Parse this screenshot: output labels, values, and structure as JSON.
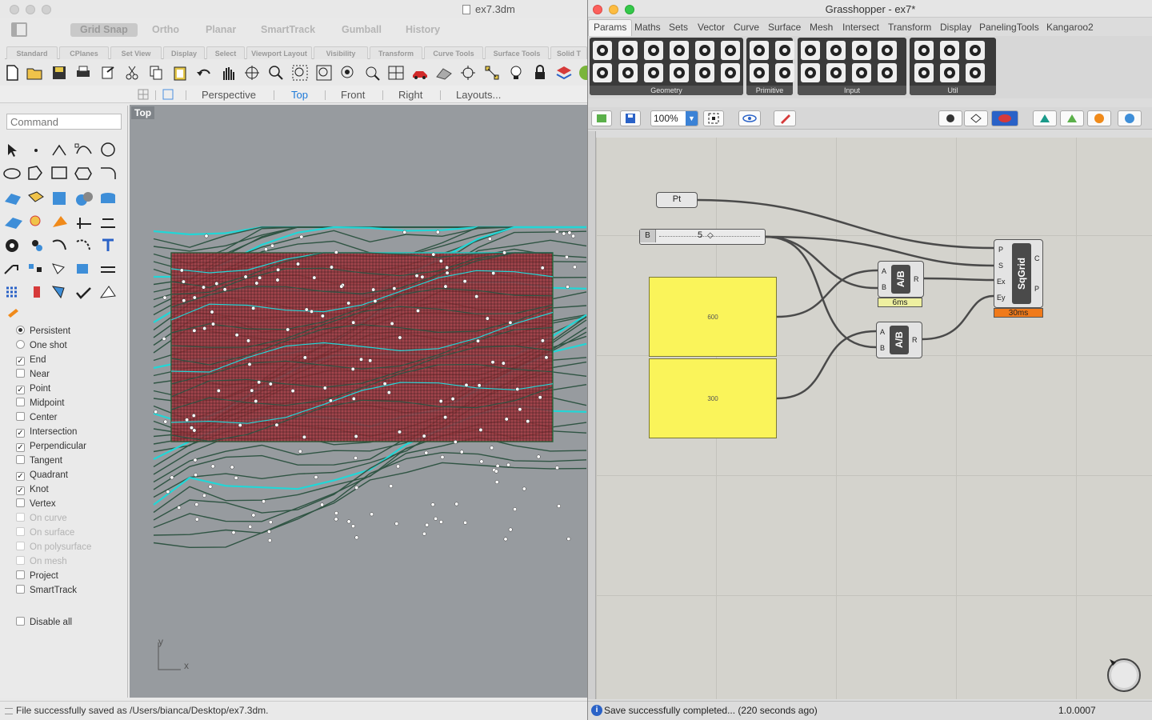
{
  "rhino": {
    "title": "ex7.3dm",
    "modes": [
      "Grid Snap",
      "Ortho",
      "Planar",
      "SmartTrack",
      "Gumball",
      "History"
    ],
    "tabs": [
      "Standard",
      "CPlanes",
      "Set View",
      "Display",
      "Select",
      "Viewport Layout",
      "Visibility",
      "Transform",
      "Curve Tools",
      "Surface Tools",
      "Solid T"
    ],
    "views": [
      "Perspective",
      "Top",
      "Front",
      "Right",
      "Layouts..."
    ],
    "active_view": "Top",
    "command_placeholder": "Command",
    "viewport_label": "Top",
    "axis_y": "y",
    "axis_x": "x",
    "osnaps": [
      {
        "label": "Persistent",
        "type": "radio",
        "checked": true,
        "enabled": true
      },
      {
        "label": "One shot",
        "type": "radio",
        "checked": false,
        "enabled": true
      },
      {
        "label": "End",
        "type": "check",
        "checked": true,
        "enabled": true
      },
      {
        "label": "Near",
        "type": "check",
        "checked": false,
        "enabled": true
      },
      {
        "label": "Point",
        "type": "check",
        "checked": true,
        "enabled": true
      },
      {
        "label": "Midpoint",
        "type": "check",
        "checked": false,
        "enabled": true
      },
      {
        "label": "Center",
        "type": "check",
        "checked": false,
        "enabled": true
      },
      {
        "label": "Intersection",
        "type": "check",
        "checked": true,
        "enabled": true
      },
      {
        "label": "Perpendicular",
        "type": "check",
        "checked": true,
        "enabled": true
      },
      {
        "label": "Tangent",
        "type": "check",
        "checked": false,
        "enabled": true
      },
      {
        "label": "Quadrant",
        "type": "check",
        "checked": true,
        "enabled": true
      },
      {
        "label": "Knot",
        "type": "check",
        "checked": true,
        "enabled": true
      },
      {
        "label": "Vertex",
        "type": "check",
        "checked": false,
        "enabled": true
      },
      {
        "label": "On curve",
        "type": "check",
        "checked": false,
        "enabled": false
      },
      {
        "label": "On surface",
        "type": "check",
        "checked": false,
        "enabled": false
      },
      {
        "label": "On polysurface",
        "type": "check",
        "checked": false,
        "enabled": false
      },
      {
        "label": "On mesh",
        "type": "check",
        "checked": false,
        "enabled": false
      },
      {
        "label": "Project",
        "type": "check",
        "checked": false,
        "enabled": true
      },
      {
        "label": "SmartTrack",
        "type": "check",
        "checked": false,
        "enabled": true
      }
    ],
    "disable_all": "Disable all",
    "status": "File successfully saved as /Users/bianca/Desktop/ex7.3dm.",
    "colors": {
      "grid": "#a3353d",
      "contour": "#2f5443",
      "highlight": "#22d6d6",
      "viewport_bg": "#979b9f"
    }
  },
  "grasshopper": {
    "title": "Grasshopper - ex7*",
    "tabs": [
      "Params",
      "Maths",
      "Sets",
      "Vector",
      "Curve",
      "Surface",
      "Mesh",
      "Intersect",
      "Transform",
      "Display",
      "PanelingTools",
      "Kangaroo2"
    ],
    "active_tab": "Params",
    "panels": [
      "Geometry",
      "Primitive",
      "Input",
      "Util"
    ],
    "zoom": "100%",
    "canvas": {
      "pt_label": "Pt",
      "slider": {
        "letter": "B",
        "value": "5"
      },
      "panel1_value": "600",
      "panel2_value": "300",
      "div1": {
        "inputs": [
          "A",
          "B"
        ],
        "name": "A/B",
        "output": "R",
        "time": "6ms"
      },
      "div2": {
        "inputs": [
          "A",
          "B"
        ],
        "name": "A/B",
        "output": "R"
      },
      "sqgrid": {
        "inputs": [
          "P",
          "S",
          "Ex",
          "Ey"
        ],
        "name": "SqGrid",
        "outputs": [
          "C",
          "P"
        ],
        "time": "30ms"
      }
    },
    "status": "Save successfully completed... (220 seconds ago)",
    "version": "1.0.0007",
    "status_icon": "i"
  }
}
